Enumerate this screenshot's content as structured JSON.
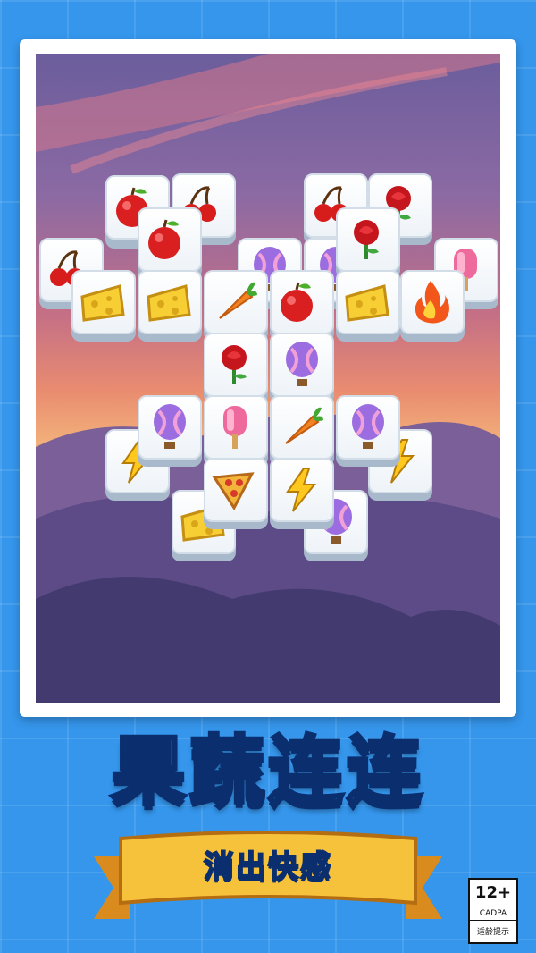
{
  "game": {
    "title": "果蔬连连",
    "subtitle": "消出快感",
    "age_rating": {
      "number": "12+",
      "org": "CADPA",
      "tip": "适龄提示"
    }
  },
  "colors": {
    "background": "#3596ec",
    "title_fill": "#1ac8f5",
    "title_outline": "#0a2e6e",
    "ribbon": "#f3b431"
  },
  "board": {
    "tiles": [
      {
        "icon": "cherry-icon"
      },
      {
        "icon": "pizza-icon"
      },
      {
        "icon": "cherry-icon"
      },
      {
        "icon": "apple-icon"
      },
      {
        "icon": "rose-icon"
      },
      {
        "icon": "apple-icon"
      },
      {
        "icon": "rose-icon"
      },
      {
        "icon": "cherry-icon"
      },
      {
        "icon": "balloon-icon"
      },
      {
        "icon": "balloon-icon"
      },
      {
        "icon": "popsicle-icon"
      },
      {
        "icon": "cheese-icon"
      },
      {
        "icon": "cheese-icon"
      },
      {
        "icon": "carrot-icon"
      },
      {
        "icon": "apple-icon"
      },
      {
        "icon": "cheese-icon"
      },
      {
        "icon": "fire-icon"
      },
      {
        "icon": "rose-icon"
      },
      {
        "icon": "balloon-icon"
      },
      {
        "icon": "balloon-icon"
      },
      {
        "icon": "popsicle-icon"
      },
      {
        "icon": "carrot-icon"
      },
      {
        "icon": "balloon-icon"
      },
      {
        "icon": "lightning-icon"
      },
      {
        "icon": "lightning-icon"
      },
      {
        "icon": "pizza-icon"
      },
      {
        "icon": "lightning-icon"
      },
      {
        "icon": "cheese-icon"
      },
      {
        "icon": "balloon-icon"
      }
    ]
  }
}
